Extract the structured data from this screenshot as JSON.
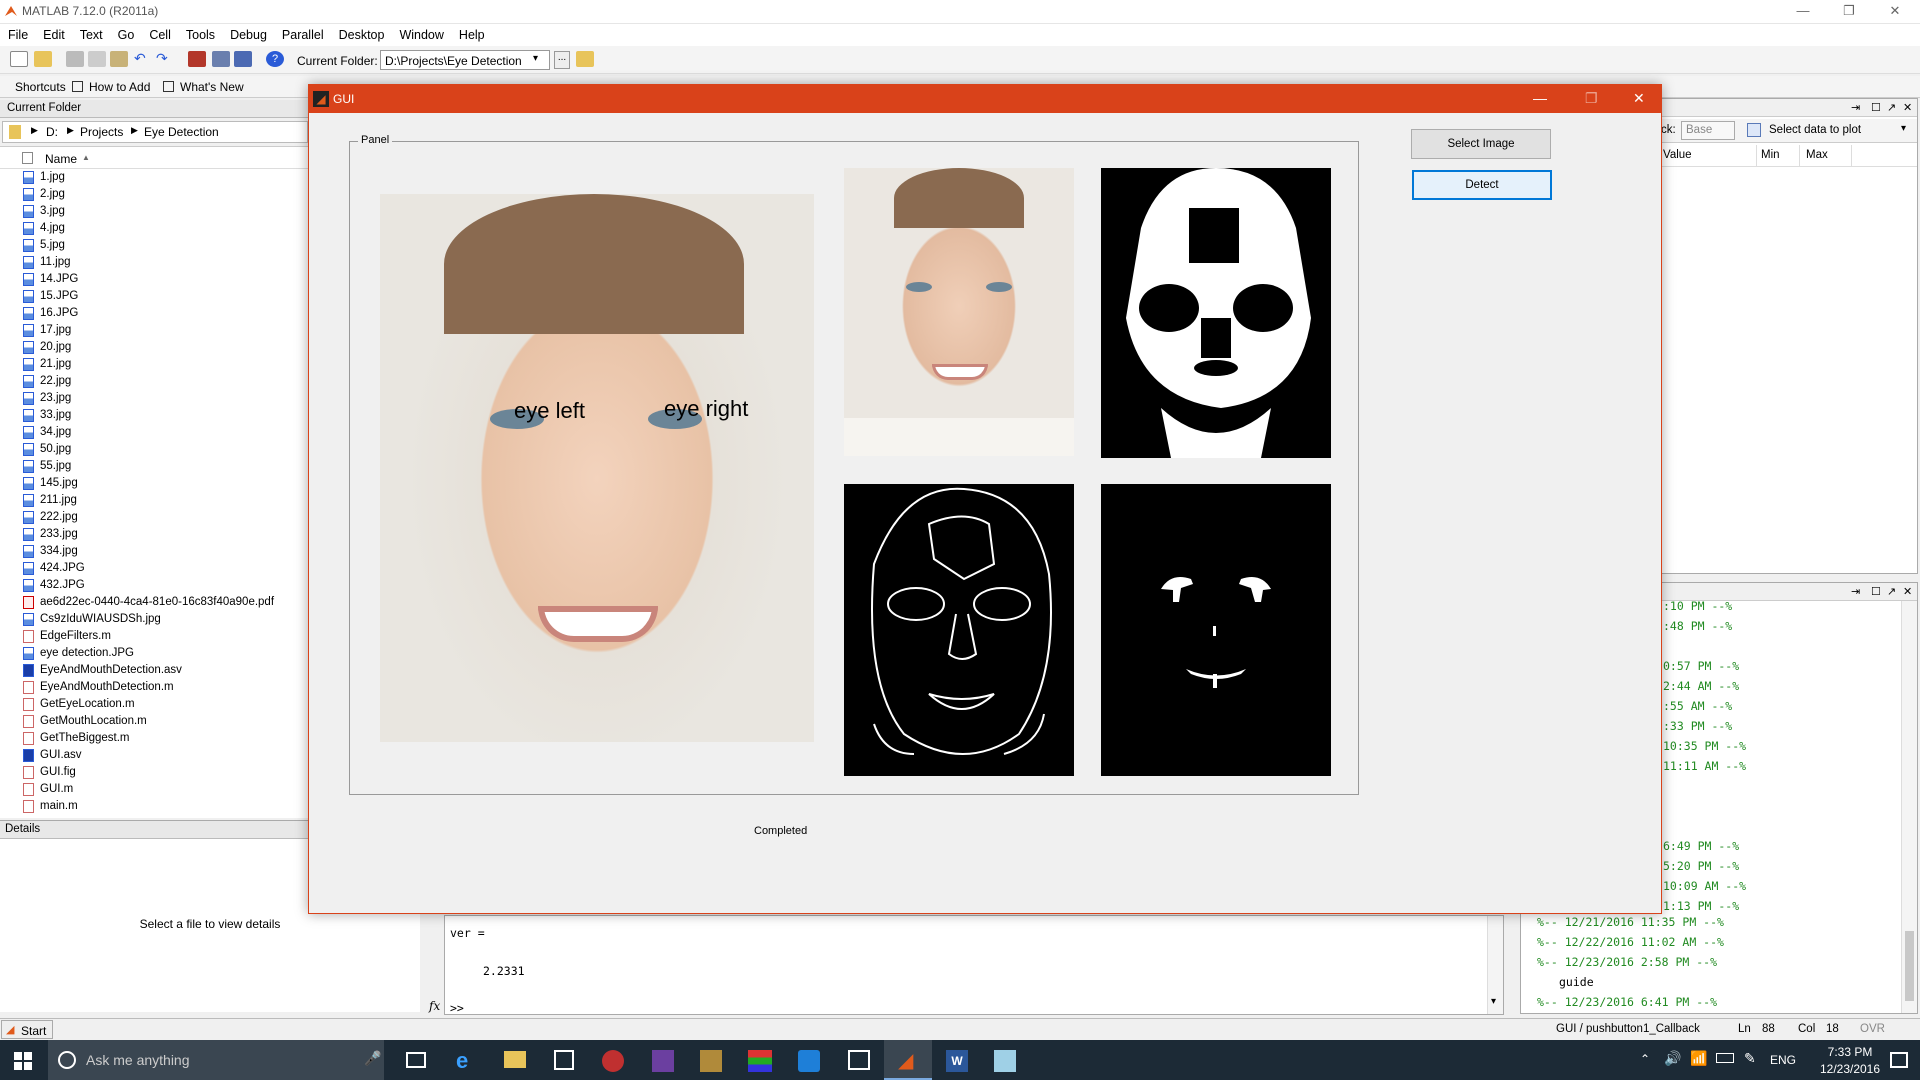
{
  "window": {
    "title": "MATLAB  7.12.0 (R2011a)",
    "minimize": "—",
    "restore": "❐",
    "close": "✕"
  },
  "menu": [
    "File",
    "Edit",
    "Text",
    "Go",
    "Cell",
    "Tools",
    "Debug",
    "Parallel",
    "Desktop",
    "Window",
    "Help"
  ],
  "toolbar": {
    "current_folder_label": "Current Folder:",
    "current_folder_value": "D:\\Projects\\Eye Detection",
    "browse_label": "..."
  },
  "shortcuts": {
    "label": "Shortcuts",
    "how_to_add": "How to Add",
    "whats_new": "What's New"
  },
  "current_folder": {
    "title": "Current Folder",
    "path": [
      "D:",
      "Projects",
      "Eye Detection"
    ],
    "column_name": "Name",
    "sort_indicator": "▲",
    "files": [
      {
        "name": "1.jpg",
        "type": "img"
      },
      {
        "name": "2.jpg",
        "type": "img"
      },
      {
        "name": "3.jpg",
        "type": "img"
      },
      {
        "name": "4.jpg",
        "type": "img"
      },
      {
        "name": "5.jpg",
        "type": "img"
      },
      {
        "name": "11.jpg",
        "type": "img"
      },
      {
        "name": "14.JPG",
        "type": "img"
      },
      {
        "name": "15.JPG",
        "type": "img"
      },
      {
        "name": "16.JPG",
        "type": "img"
      },
      {
        "name": "17.jpg",
        "type": "img"
      },
      {
        "name": "20.jpg",
        "type": "img"
      },
      {
        "name": "21.jpg",
        "type": "img"
      },
      {
        "name": "22.jpg",
        "type": "img"
      },
      {
        "name": "23.jpg",
        "type": "img"
      },
      {
        "name": "33.jpg",
        "type": "img"
      },
      {
        "name": "34.jpg",
        "type": "img"
      },
      {
        "name": "50.jpg",
        "type": "img"
      },
      {
        "name": "55.jpg",
        "type": "img"
      },
      {
        "name": "145.jpg",
        "type": "img"
      },
      {
        "name": "211.jpg",
        "type": "img"
      },
      {
        "name": "222.jpg",
        "type": "img"
      },
      {
        "name": "233.jpg",
        "type": "img"
      },
      {
        "name": "334.jpg",
        "type": "img"
      },
      {
        "name": "424.JPG",
        "type": "img"
      },
      {
        "name": "432.JPG",
        "type": "img"
      },
      {
        "name": "ae6d22ec-0440-4ca4-81e0-16c83f40a90e.pdf",
        "type": "pdf"
      },
      {
        "name": "Cs9zIduWIAUSDSh.jpg",
        "type": "img"
      },
      {
        "name": "EdgeFilters.m",
        "type": "m"
      },
      {
        "name": "eye detection.JPG",
        "type": "img"
      },
      {
        "name": "EyeAndMouthDetection.asv",
        "type": "asv"
      },
      {
        "name": "EyeAndMouthDetection.m",
        "type": "m"
      },
      {
        "name": "GetEyeLocation.m",
        "type": "m"
      },
      {
        "name": "GetMouthLocation.m",
        "type": "m"
      },
      {
        "name": "GetTheBiggest.m",
        "type": "m"
      },
      {
        "name": "GUI.asv",
        "type": "asv"
      },
      {
        "name": "GUI.fig",
        "type": "m"
      },
      {
        "name": "GUI.m",
        "type": "m"
      },
      {
        "name": "main.m",
        "type": "m"
      }
    ]
  },
  "details": {
    "title": "Details",
    "message": "Select a file to view details"
  },
  "workspace": {
    "stack_label": "ck:",
    "stack_value": "Base",
    "plot_label": "Select data to plot",
    "columns": [
      "Value",
      "Min",
      "Max"
    ]
  },
  "history": {
    "lines": [
      ":10 PM --%",
      ":48 PM --%",
      "",
      "0:57 PM --%",
      "2:44 AM --%",
      ":55 AM --%",
      ":33 PM --%",
      "10:35 PM --%",
      "11:11 AM --%",
      "",
      "",
      "",
      "6:49 PM --%",
      "5:20 PM --%",
      "10:09 AM --%",
      "1:13 PM --%"
    ],
    "tree": [
      {
        "prefix": "%-- ",
        "text": "12/21/2016 11:35 PM --%"
      },
      {
        "prefix": "%-- ",
        "text": "12/22/2016 11:02 AM --%"
      },
      {
        "prefix": "%-- ",
        "text": "12/23/2016 2:58 PM --%"
      },
      {
        "prefix": "",
        "text": "guide"
      },
      {
        "prefix": "%-- ",
        "text": "12/23/2016 6:41 PM --%"
      }
    ]
  },
  "command": {
    "line1": "ver =",
    "line2": "2.2331",
    "prompt": ">>",
    "fx": "fx"
  },
  "status": {
    "start": "Start",
    "callback": "GUI / pushbutton1_Callback",
    "ln_label": "Ln",
    "ln": "88",
    "col_label": "Col",
    "col": "18",
    "ovr": "OVR"
  },
  "gui": {
    "title": "GUI",
    "panel_label": "Panel",
    "select_button": "Select Image",
    "detect_button": "Detect",
    "status_text": "Completed",
    "eye_left_label": "eye left",
    "eye_right_label": "eye right"
  },
  "taskbar": {
    "search_placeholder": "Ask me anything",
    "lang": "ENG",
    "time": "7:33 PM",
    "date": "12/23/2016"
  }
}
